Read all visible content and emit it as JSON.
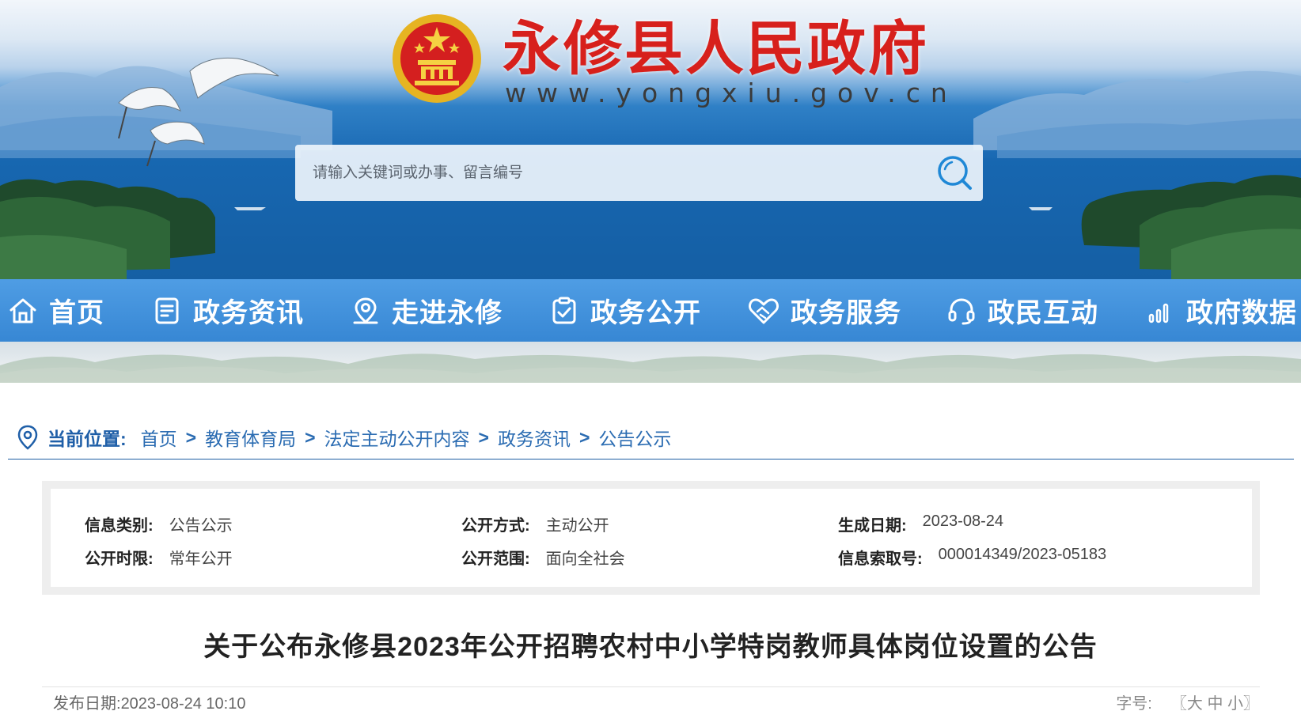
{
  "header": {
    "site_title": "永修县人民政府",
    "site_url": "www.yongxiu.gov.cn",
    "search": {
      "placeholder": "请输入关键词或办事、留言编号",
      "icon": "search-icon"
    }
  },
  "nav": {
    "items": [
      {
        "label": "首页",
        "icon": "home-icon"
      },
      {
        "label": "政务资讯",
        "icon": "document-icon"
      },
      {
        "label": "走进永修",
        "icon": "location-pin-icon"
      },
      {
        "label": "政务公开",
        "icon": "clipboard-check-icon"
      },
      {
        "label": "政务服务",
        "icon": "heart-handshake-icon"
      },
      {
        "label": "政民互动",
        "icon": "headset-icon"
      },
      {
        "label": "政府数据",
        "icon": "bar-chart-icon"
      }
    ]
  },
  "breadcrumb": {
    "label": "当前位置:",
    "items": [
      "首页",
      "教育体育局",
      "法定主动公开内容",
      "政务资讯",
      "公告公示"
    ],
    "separator": ">"
  },
  "info": {
    "category_label": "信息类别:",
    "category_value": "公告公示",
    "method_label": "公开方式:",
    "method_value": "主动公开",
    "date_label": "生成日期:",
    "date_value": "2023-08-24",
    "term_label": "公开时限:",
    "term_value": "常年公开",
    "scope_label": "公开范围:",
    "scope_value": "面向全社会",
    "index_label": "信息索取号:",
    "index_value": "000014349/2023-05183"
  },
  "article": {
    "title": "关于公布永修县2023年公开招聘农村中小学特岗教师具体岗位设置的公告",
    "publish_label": "发布日期:",
    "publish_value": "2023-08-24 10:10",
    "font_size_label": "字号:",
    "font_size_open": "〖",
    "font_size_large": "大",
    "font_size_medium": "中",
    "font_size_small": "小",
    "font_size_close": "〗"
  },
  "colors": {
    "title_red": "#d7201c",
    "nav_blue": "#3787d4",
    "link_blue": "#2b6cb2"
  }
}
